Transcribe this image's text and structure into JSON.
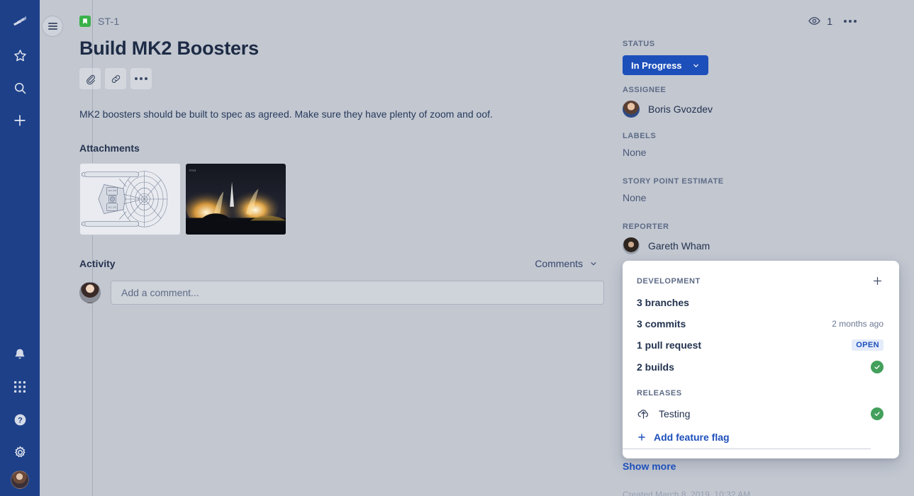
{
  "rail": {
    "logo_icon": "atlassian-jira-logo-icon",
    "top_items": [
      {
        "icon": "star-icon",
        "name": "starred"
      },
      {
        "icon": "search-icon",
        "name": "search"
      },
      {
        "icon": "plus-icon",
        "name": "create"
      }
    ],
    "bottom_items": [
      {
        "icon": "notification-bell-icon",
        "name": "notifications"
      },
      {
        "icon": "app-switcher-grid-icon",
        "name": "app-switcher"
      },
      {
        "icon": "help-question-icon",
        "name": "help"
      },
      {
        "icon": "settings-gear-icon",
        "name": "settings"
      }
    ],
    "profile_avatar": "user-avatar"
  },
  "nav_toggle": {
    "icon": "hamburger-menu-icon"
  },
  "header": {
    "issue_type_icon": "story-bookmark-icon",
    "issue_key": "ST-1",
    "title": "Build MK2 Boosters",
    "actions": [
      {
        "icon": "paperclip-attach-icon",
        "name": "attach"
      },
      {
        "icon": "link-icon",
        "name": "add-link"
      },
      {
        "icon": "ellipsis-icon",
        "name": "more-actions"
      }
    ],
    "watch_icon": "eye-watch-icon",
    "watch_count": "1",
    "more_icon": "ellipsis-icon"
  },
  "description": "MK2 boosters should be built to spec as agreed. Make sure they have plenty of zoom and oof.",
  "attachments": {
    "heading": "Attachments",
    "items": [
      {
        "name": "starship-schematic-thumbnail",
        "kind": "blueprint"
      },
      {
        "name": "rocket-launch-photo-thumbnail",
        "kind": "photo",
        "watermark": "esa"
      }
    ]
  },
  "activity": {
    "heading": "Activity",
    "filter_label": "Comments",
    "filter_icon": "chevron-down-icon",
    "comment_placeholder": "Add a comment...",
    "avatar": "current-user-avatar"
  },
  "sidebar": {
    "status": {
      "label": "Status",
      "value": "In Progress",
      "icon": "chevron-down-icon",
      "color": "#1d4fbb"
    },
    "assignee": {
      "label": "Assignee",
      "value": "Boris Gvozdev"
    },
    "labels": {
      "label": "Labels",
      "value": "None"
    },
    "story_points": {
      "label": "Story point estimate",
      "value": "None"
    },
    "reporter": {
      "label": "Reporter",
      "value": "Gareth Wham"
    },
    "show_more": "Show more",
    "created_line": "Created March 8, 2019, 10:32 AM"
  },
  "development": {
    "label": "Development",
    "add_icon": "plus-icon",
    "rows": [
      {
        "link": "3 branches",
        "meta": "",
        "badge": "",
        "status_icon": ""
      },
      {
        "link": "3 commits",
        "meta": "2 months ago",
        "badge": "",
        "status_icon": ""
      },
      {
        "link": "1 pull request",
        "meta": "",
        "badge": "OPEN",
        "status_icon": ""
      },
      {
        "link": "2 builds",
        "meta": "",
        "badge": "",
        "status_icon": "check-success-icon"
      }
    ],
    "releases_label": "Releases",
    "release": {
      "icon": "cloud-upload-icon",
      "name": "Testing",
      "status_icon": "check-success-icon"
    },
    "feature_flag": {
      "icon": "plus-icon",
      "label": "Add feature flag"
    }
  }
}
